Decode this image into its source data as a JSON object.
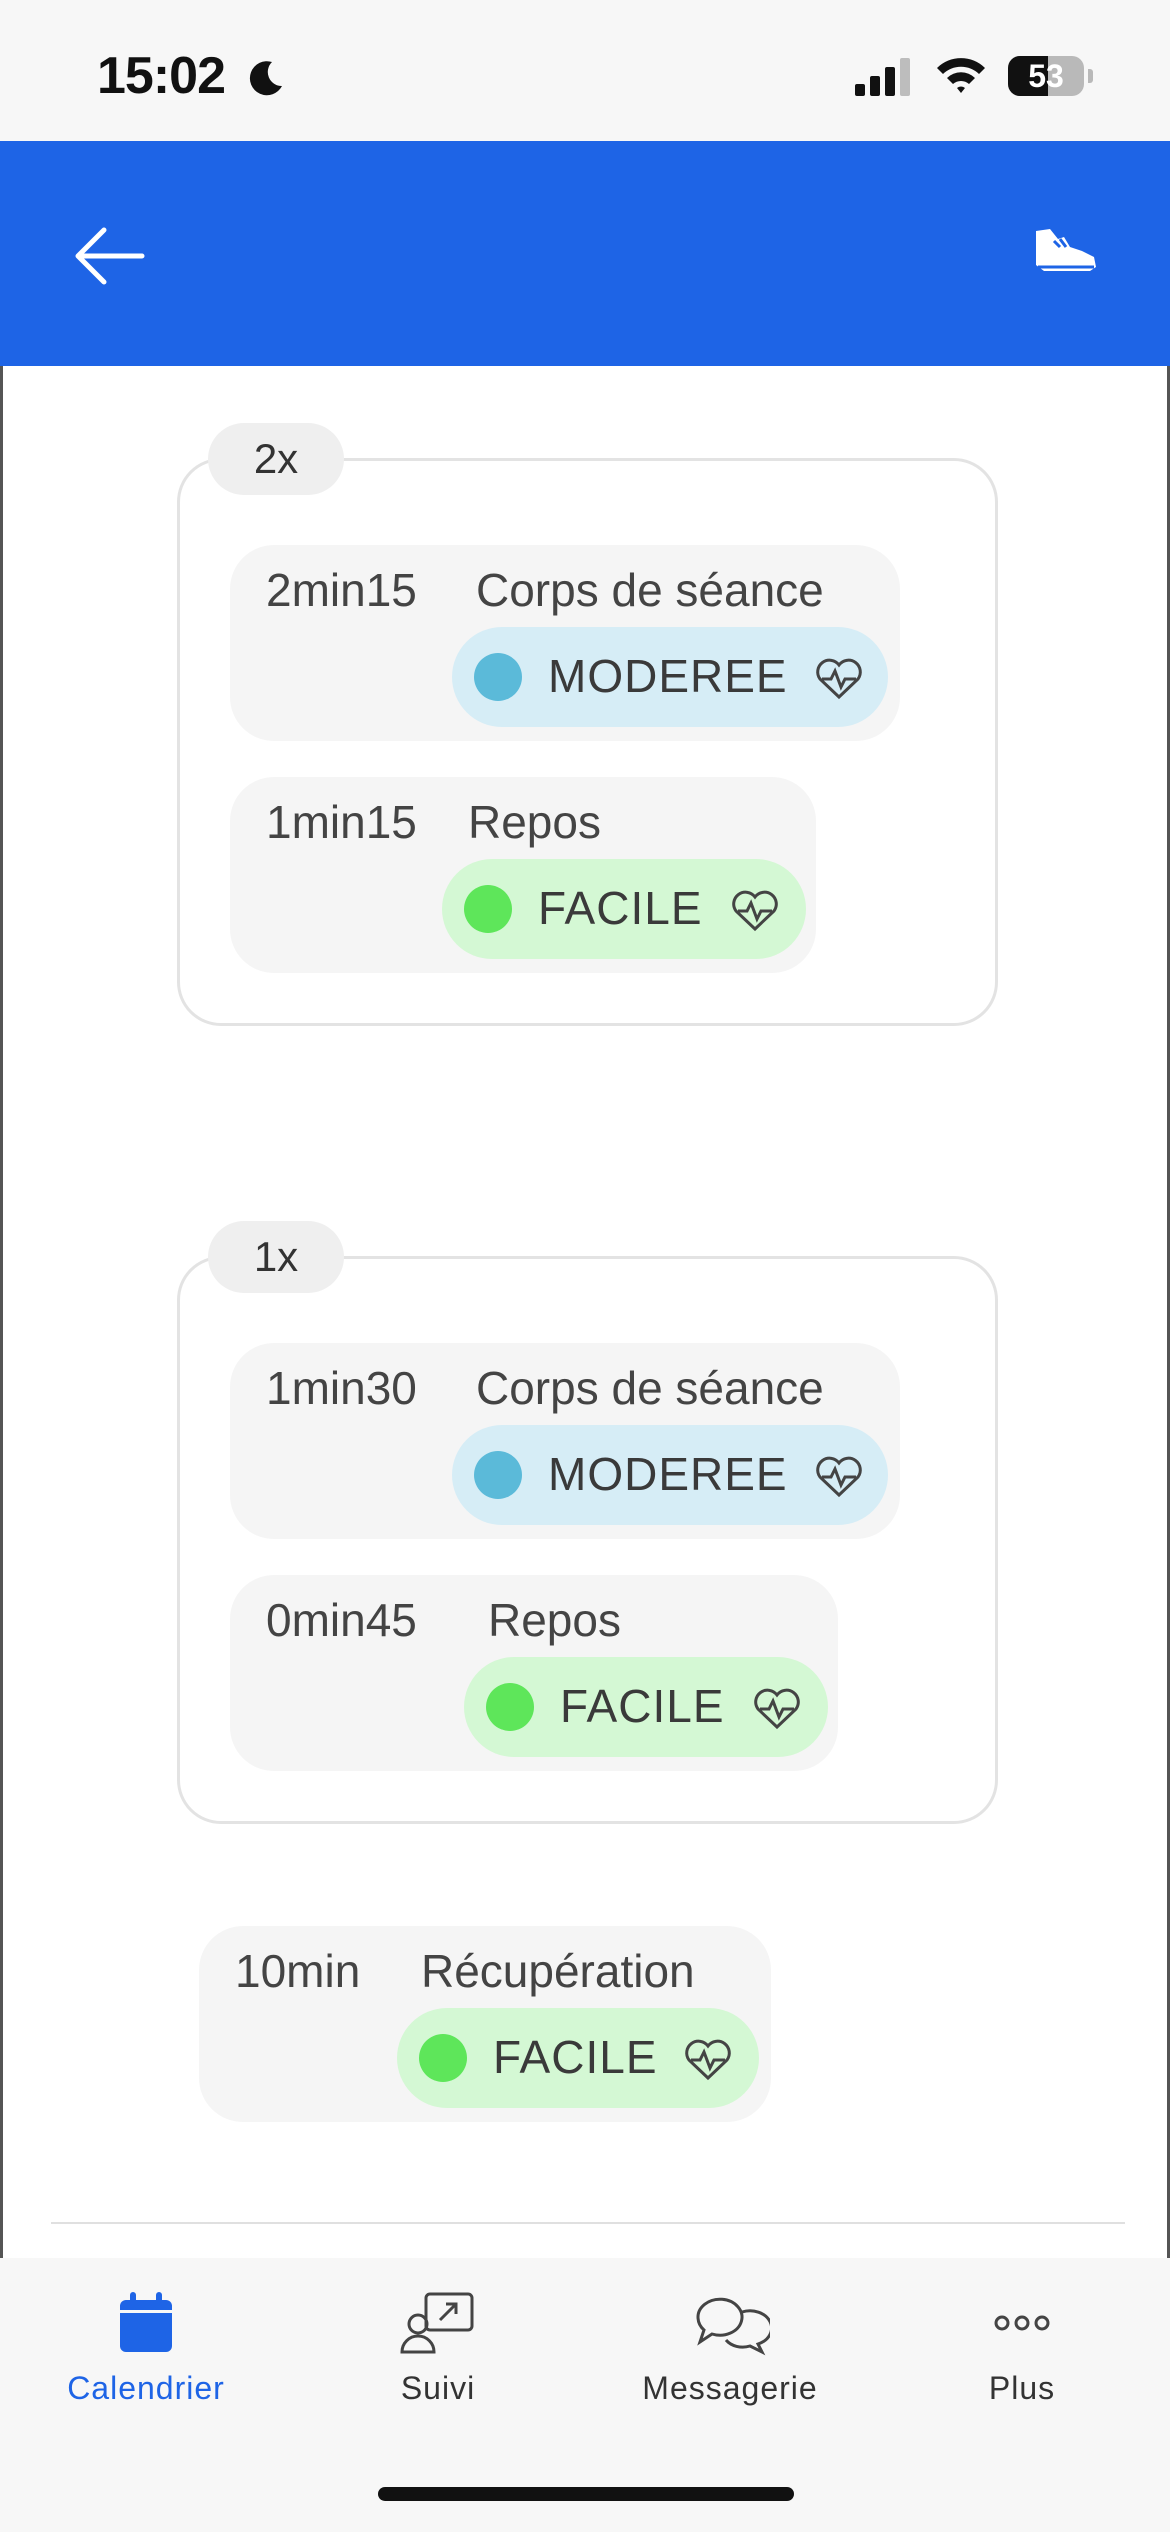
{
  "status_bar": {
    "time": "15:02",
    "battery": "53",
    "battery_percent": 53
  },
  "header": {
    "back_icon": "arrow-left-icon",
    "action_icon": "running-shoe-icon",
    "background": "#1e64e6"
  },
  "groups": [
    {
      "repeat": "2x",
      "steps": [
        {
          "duration": "2min15",
          "title": "Corps de séance",
          "intensity": "MODEREE",
          "level": "moderee"
        },
        {
          "duration": "1min15",
          "title": "Repos",
          "intensity": "FACILE",
          "level": "facile"
        }
      ]
    },
    {
      "repeat": "1x",
      "steps": [
        {
          "duration": "1min30",
          "title": "Corps de séance",
          "intensity": "MODEREE",
          "level": "moderee"
        },
        {
          "duration": "0min45",
          "title": "Repos",
          "intensity": "FACILE",
          "level": "facile"
        }
      ]
    }
  ],
  "recovery": {
    "duration": "10min",
    "title": "Récupération",
    "intensity": "FACILE",
    "level": "facile"
  },
  "colors": {
    "moderee_bg": "#d6edf6",
    "moderee_dot": "#5bbad9",
    "facile_bg": "#d4f8d4",
    "facile_dot": "#5ee65a",
    "active_tab": "#1e64e6"
  },
  "tabs": [
    {
      "label": "Calendrier",
      "icon": "calendar-icon",
      "active": true
    },
    {
      "label": "Suivi",
      "icon": "tracking-icon",
      "active": false
    },
    {
      "label": "Messagerie",
      "icon": "chat-icon",
      "active": false
    },
    {
      "label": "Plus",
      "icon": "more-icon",
      "active": false
    }
  ]
}
